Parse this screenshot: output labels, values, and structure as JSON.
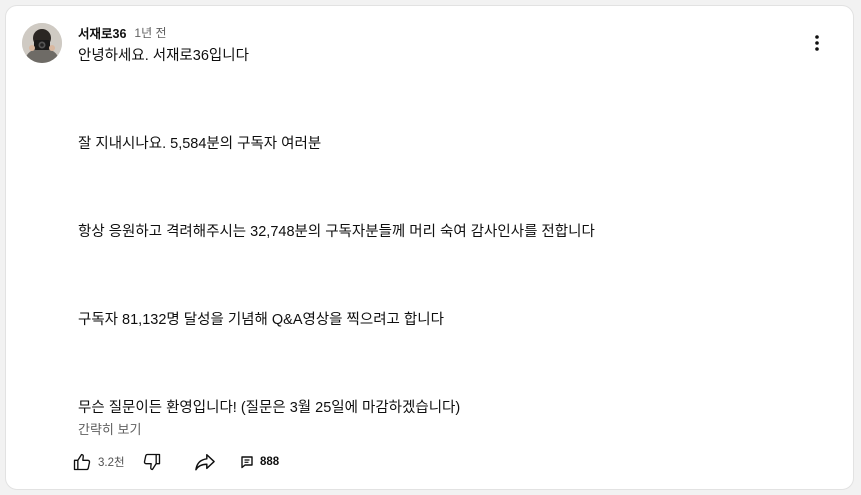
{
  "comment": {
    "author": "서재로36",
    "time": "1년 전",
    "paragraphs": [
      "안녕하세요. 서재로36입니다",
      "잘 지내시나요. 5,584분의 구독자 여러분",
      "항상 응원하고 격려해주시는 32,748분의 구독자분들께 머리 숙여 감사인사를 전합니다",
      "구독자 81,132명 달성을 기념해 Q&A영상을 찍으려고 합니다",
      "무슨 질문이든 환영입니다! (질문은 3월 25일에 마감하겠습니다)"
    ],
    "collapse_label": "간략히 보기",
    "like_count": "3.2천",
    "reply_count": "888"
  },
  "icons": {
    "menu": "more-vert-icon",
    "like": "thumb-up-icon",
    "dislike": "thumb-down-icon",
    "share": "share-icon",
    "reply": "comment-icon"
  }
}
